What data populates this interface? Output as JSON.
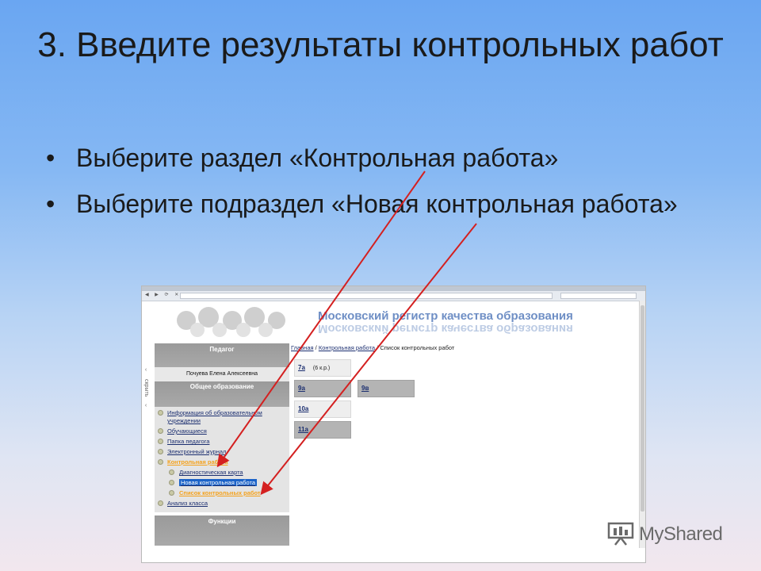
{
  "slide": {
    "title": "3. Введите результаты контрольных работ",
    "bullets": [
      "Выберите раздел «Контрольная работа»",
      "Выберите подраздел «Новая контрольная работа»"
    ],
    "bullet_symbol": "•"
  },
  "screenshot": {
    "site_title": "Московский регистр качества образования",
    "hide_label": "скрыть",
    "sidebar": {
      "teacher_header": "Педагог",
      "teacher_name": "Почуева Елена Алексеевна",
      "section_header": "Общее образование",
      "menu": [
        {
          "label": "Информация об образовательном учреждении",
          "level": 1,
          "state": "normal"
        },
        {
          "label": "Обучающиеся",
          "level": 1,
          "state": "normal"
        },
        {
          "label": "Папка педагога",
          "level": 1,
          "state": "normal"
        },
        {
          "label": "Электронный журнал",
          "level": 1,
          "state": "normal"
        },
        {
          "label": "Контрольная работа",
          "level": 1,
          "state": "active"
        },
        {
          "label": "Диагностическая карта",
          "level": 2,
          "state": "normal"
        },
        {
          "label": "Новая контрольная работа",
          "level": 2,
          "state": "selected"
        },
        {
          "label": "Список контрольных работ",
          "level": 2,
          "state": "current"
        },
        {
          "label": "Анализ класса",
          "level": 1,
          "state": "normal"
        }
      ],
      "functions_header": "Функции"
    },
    "breadcrumb": {
      "home": "Главная",
      "sep": "/",
      "section": "Контрольная работа",
      "current": "Список контрольных работ"
    },
    "classes": [
      {
        "name": "7а",
        "count": "(6 к.р.)",
        "style": "light"
      },
      {
        "name": "9а",
        "count": "",
        "style": "dark"
      },
      {
        "name": "9в",
        "count": "",
        "style": "dark"
      },
      {
        "name": "10а",
        "count": "",
        "style": "light"
      },
      {
        "name": "11а",
        "count": "",
        "style": "dark"
      }
    ]
  },
  "watermark": {
    "text": "MyShared",
    "icon": "presentation-board-icon"
  },
  "colors": {
    "arrow": "#d42020",
    "active_menu": "#f4a11b",
    "selected_menu_bg": "#1b63c8",
    "link": "#1c2f70",
    "site_title": "#6f8fc5"
  }
}
